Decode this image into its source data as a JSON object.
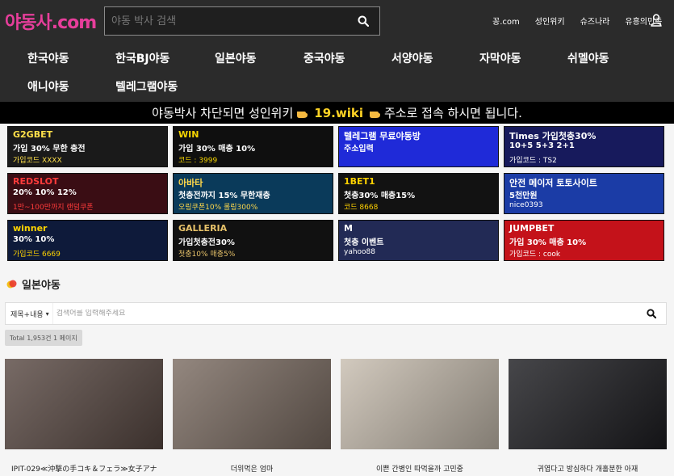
{
  "header": {
    "logo": "야동사.com",
    "search_placeholder": "야동 박사 검색",
    "links": [
      "꽁.com",
      "성인위키",
      "슈즈나라",
      "유흥의민족"
    ]
  },
  "nav": [
    "한국야동",
    "한국BJ야동",
    "일본야동",
    "중국야동",
    "서양야동",
    "자막야동",
    "쉬멜야동",
    "애니야동",
    "텔레그램야동"
  ],
  "notice": {
    "before": "야동박사 차단되면 성인위키",
    "wiki": "19.wiki",
    "after": "주소로 접속 하시면 됩니다."
  },
  "banners": [
    {
      "title": "G2GBET",
      "line1": "가입 30% 무한 충전",
      "line2": "가입코드 XXXX",
      "bg": "#1a1a1a",
      "fg": "#ffe14a"
    },
    {
      "title": "WIN",
      "line1": "가입 30% 매충 10%",
      "line2": "코드 : 3999",
      "bg": "#0f0f0f",
      "fg": "#f5d400"
    },
    {
      "title": "텔레그램 무료야동방",
      "line1": "주소입력",
      "line2": "",
      "bg": "#1f2ad8",
      "fg": "#ffffff"
    },
    {
      "title": "Times 가입첫충30%",
      "line1": "10+5 5+3 2+1",
      "line2": "가입코드 : TS2",
      "bg": "#171a5c",
      "fg": "#ffffff"
    },
    {
      "title": "REDSLOT",
      "line1": "20% 10% 12%",
      "line2": "1만~100만까지 랜덤쿠폰",
      "bg": "#3a0d14",
      "fg": "#ff3b3b"
    },
    {
      "title": "아바타",
      "line1": "첫충전까지 15% 무한재충",
      "line2": "오링쿠폰10% 롤링300%",
      "bg": "#0a3a5a",
      "fg": "#ffd84a"
    },
    {
      "title": "1BET1",
      "line1": "첫충30% 매충15%",
      "line2": "코드 8668",
      "bg": "#121212",
      "fg": "#ffd200"
    },
    {
      "title": "안전 메이저 토토사이트",
      "line1": "5천만원",
      "line2": "nice0393",
      "bg": "#1b3ca6",
      "fg": "#ffffff"
    },
    {
      "title": "winner",
      "line1": "30% 10%",
      "line2": "가입코드 6669",
      "bg": "#0e1a3a",
      "fg": "#ffd400"
    },
    {
      "title": "GALLERIA",
      "line1": "가입첫충전30%",
      "line2": "첫충10% 매충5%",
      "bg": "#111111",
      "fg": "#e8c36a"
    },
    {
      "title": "M",
      "line1": "첫충 이벤트",
      "line2": "yahoo88",
      "bg": "#222a55",
      "fg": "#ffffff"
    },
    {
      "title": "JUMPBET",
      "line1": "가입 30% 매충 10%",
      "line2": "가입코드 : cook",
      "bg": "#c4121a",
      "fg": "#ffffff"
    }
  ],
  "section": {
    "title": "일본야동",
    "select_label": "제목+내용",
    "search_placeholder": "검색어를 입력해주세요",
    "total": "Total 1,953건 1 페이지"
  },
  "videos": [
    {
      "title": "IPIT-029≪沖撃の手コキ＆フェラ≫女子アナ",
      "bg": "#5a4a44"
    },
    {
      "title": "더위먹은 엄마",
      "bg": "#7c6d63"
    },
    {
      "title": "이쁜 간병인 따먹을까 고민중",
      "bg": "#c8beb0"
    },
    {
      "title": "귀엽다고 방심하다 개홀분한 아재",
      "bg": "#1e1e22"
    }
  ]
}
